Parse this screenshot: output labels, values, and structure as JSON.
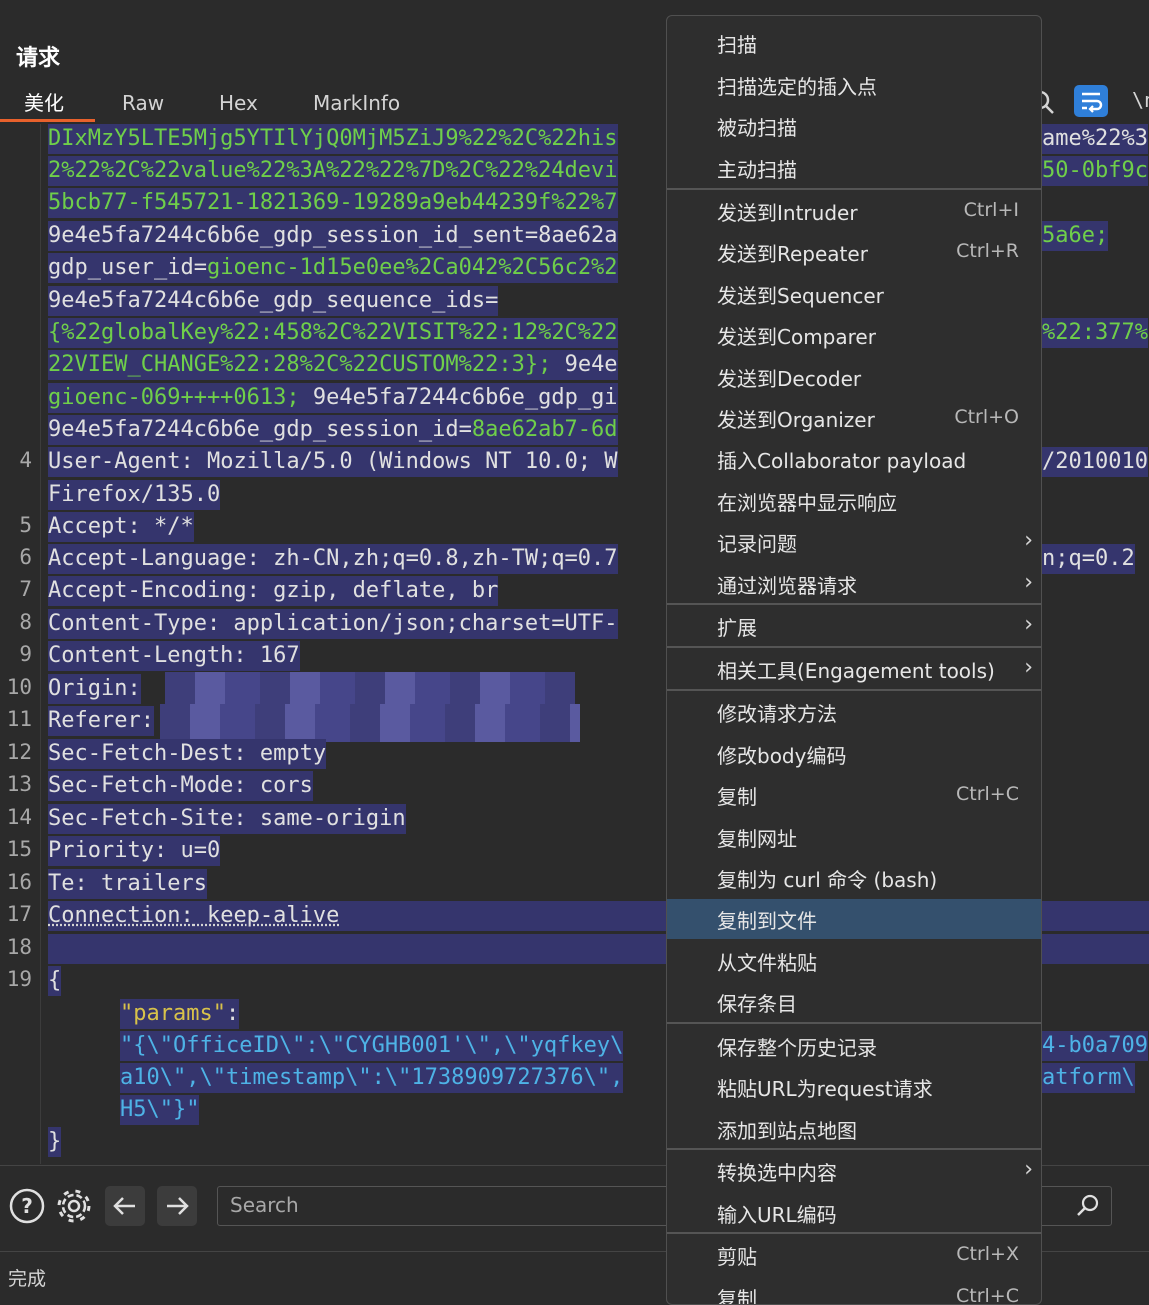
{
  "panel": {
    "title": "请求"
  },
  "tabs": [
    {
      "label": "美化"
    },
    {
      "label": "Raw"
    },
    {
      "label": "Hex"
    },
    {
      "label": "MarkInfo"
    }
  ],
  "editor": {
    "line_numbers": [
      "4",
      "5",
      "6",
      "7",
      "8",
      "9",
      "10",
      "11",
      "12",
      "13",
      "14",
      "15",
      "16",
      "17",
      "18",
      "19"
    ],
    "wrapped_lines": [
      "DIxMzY5LTE5Mjg5YTIlYjQ0MjM5ZiJ9%22%2C%22his",
      "2%22%2C%22value%22%3A%22%22%7D%2C%22%24devi",
      "5bcb77-f545721-1821369-19289a9eb44239f%22%7",
      "9e4e5fa7244c6b6e_gdp_session_id_sent=8ae62a",
      "gdp_user_id=",
      "gioenc-1d15e0ee%2Ca042%2C56c2%2",
      "9e4e5fa7244c6b6e_gdp_sequence_ids=",
      "{%22globalKey%22:458%2C%22VISIT%22:12%2C%22",
      "22VIEW_CHANGE%22:28%2C%22CUSTOM%22:3};",
      " 9e4e",
      "gioenc-069++++0613;",
      " 9e4e5fa7244c6b6e_gdp_gi",
      "9e4e5fa7244c6b6e_gdp_session_id=",
      "8ae62ab7-6d"
    ],
    "headers": [
      {
        "name": "User-Agent:",
        "value": " Mozilla/5.0 (Windows NT 10.0; W"
      },
      {
        "name": "",
        "value": "Firefox/135.0"
      },
      {
        "name": "Accept:",
        "value": " */*"
      },
      {
        "name": "Accept-Language:",
        "value": " zh-CN,zh;q=0.8,zh-TW;q=0.7"
      },
      {
        "name": "Accept-Encoding:",
        "value": " gzip, deflate, br"
      },
      {
        "name": "Content-Type:",
        "value": " application/json;charset=UTF-"
      },
      {
        "name": "Content-Length:",
        "value": " 167"
      },
      {
        "name": "Origin:",
        "value": ""
      },
      {
        "name": "Referer:",
        "value": ""
      },
      {
        "name": "Sec-Fetch-Dest:",
        "value": " empty"
      },
      {
        "name": "Sec-Fetch-Mode:",
        "value": " cors"
      },
      {
        "name": "Sec-Fetch-Site:",
        "value": " same-origin"
      },
      {
        "name": "Priority:",
        "value": " u=0"
      },
      {
        "name": "Te:",
        "value": " trailers"
      },
      {
        "name": "Connection:",
        "value": " keep-alive"
      }
    ],
    "json_open": "{",
    "json_key": "\"params\"",
    "json_colon": ":",
    "json_value_lines": [
      "\"{\\\"OfficeID\\\":\\\"CYGHB001'\\\",\\\"yqfkey\\",
      "a10\\\",\\\"timestamp\\\":\\\"1738909727376\\\",",
      "H5\\\"}\""
    ],
    "json_close": "}",
    "right_fragments": [
      "ame%22%3",
      "50-0bf9c",
      "5a6e;",
      "%22:377%",
      "/2010010",
      "n;q=0.2",
      "4-b0a709",
      "atform\\"
    ]
  },
  "toolbar": {
    "search_placeholder": "Search"
  },
  "status": {
    "text": "完成"
  },
  "context_menu": {
    "items": [
      {
        "label": "扫描",
        "shortcut": "",
        "submenu": false
      },
      {
        "label": "扫描选定的插入点",
        "shortcut": "",
        "submenu": false
      },
      {
        "label": "被动扫描",
        "shortcut": "",
        "submenu": false
      },
      {
        "label": "主动扫描",
        "shortcut": "",
        "submenu": false
      },
      {
        "label": "发送到Intruder",
        "shortcut": "Ctrl+I",
        "submenu": false
      },
      {
        "label": "发送到Repeater",
        "shortcut": "Ctrl+R",
        "submenu": false
      },
      {
        "label": "发送到Sequencer",
        "shortcut": "",
        "submenu": false
      },
      {
        "label": "发送到Comparer",
        "shortcut": "",
        "submenu": false
      },
      {
        "label": "发送到Decoder",
        "shortcut": "",
        "submenu": false
      },
      {
        "label": "发送到Organizer",
        "shortcut": "Ctrl+O",
        "submenu": false
      },
      {
        "label": "插入Collaborator payload",
        "shortcut": "",
        "submenu": false
      },
      {
        "label": "在浏览器中显示响应",
        "shortcut": "",
        "submenu": false
      },
      {
        "label": "记录问题",
        "shortcut": "",
        "submenu": true
      },
      {
        "label": "通过浏览器请求",
        "shortcut": "",
        "submenu": true
      },
      {
        "label": "扩展",
        "shortcut": "",
        "submenu": true
      },
      {
        "label": "相关工具(Engagement tools)",
        "shortcut": "",
        "submenu": true
      },
      {
        "label": "修改请求方法",
        "shortcut": "",
        "submenu": false
      },
      {
        "label": "修改body编码",
        "shortcut": "",
        "submenu": false
      },
      {
        "label": "复制",
        "shortcut": "Ctrl+C",
        "submenu": false
      },
      {
        "label": "复制网址",
        "shortcut": "",
        "submenu": false
      },
      {
        "label": "复制为 curl 命令 (bash)",
        "shortcut": "",
        "submenu": false
      },
      {
        "label": "复制到文件",
        "shortcut": "",
        "submenu": false
      },
      {
        "label": "从文件粘贴",
        "shortcut": "",
        "submenu": false
      },
      {
        "label": "保存条目",
        "shortcut": "",
        "submenu": false
      },
      {
        "label": "保存整个历史记录",
        "shortcut": "",
        "submenu": false
      },
      {
        "label": "粘贴URL为request请求",
        "shortcut": "",
        "submenu": false
      },
      {
        "label": "添加到站点地图",
        "shortcut": "",
        "submenu": false
      },
      {
        "label": "转换选中内容",
        "shortcut": "",
        "submenu": true
      },
      {
        "label": "输入URL编码",
        "shortcut": "",
        "submenu": false
      },
      {
        "label": "剪贴",
        "shortcut": "Ctrl+X",
        "submenu": false
      },
      {
        "label": "复制",
        "shortcut": "Ctrl+C",
        "submenu": false
      }
    ],
    "selected_item": "复制到文件"
  },
  "colors": {
    "background": "#2b2b2b",
    "selection": "#35356d",
    "header_name": "#e0e0e0",
    "header_value": "#e0e0e0",
    "json_key": "#d8c24a",
    "json_value": "#4eb3e6",
    "cookie_value": "#6fcf4a",
    "tab_accent": "#e8612c",
    "menu_selected": "#34506d",
    "wrap_button": "#2f7fd9"
  }
}
